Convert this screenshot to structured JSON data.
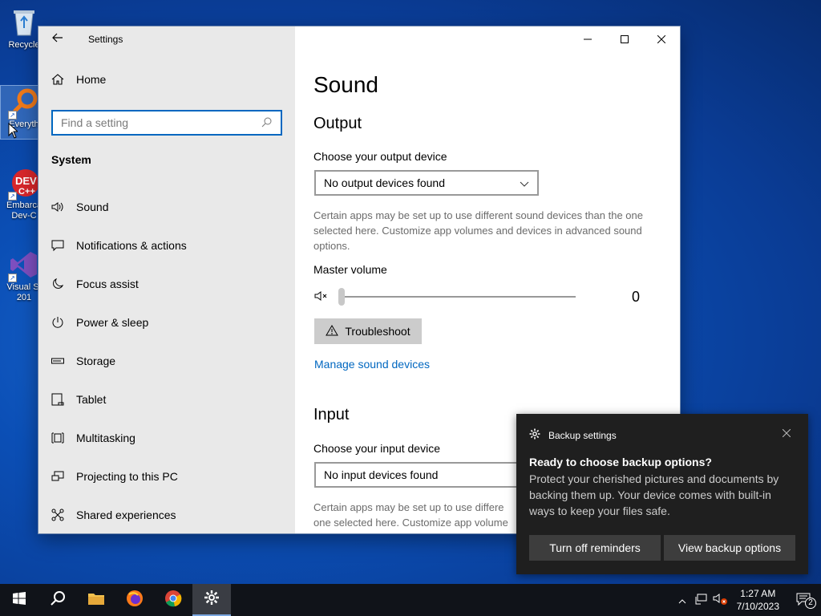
{
  "desktop": {
    "icons": [
      {
        "label": "Recycle"
      },
      {
        "label": "Everyth"
      },
      {
        "label": "Embarca\nDev-C"
      },
      {
        "label": "Visual St\n201"
      }
    ]
  },
  "window": {
    "app_title": "Settings",
    "nav": {
      "home_label": "Home",
      "search_placeholder": "Find a setting",
      "section_label": "System",
      "items": [
        {
          "label": "Sound",
          "icon": "speaker-icon"
        },
        {
          "label": "Notifications & actions",
          "icon": "notification-icon"
        },
        {
          "label": "Focus assist",
          "icon": "moon-icon"
        },
        {
          "label": "Power & sleep",
          "icon": "power-icon"
        },
        {
          "label": "Storage",
          "icon": "storage-icon"
        },
        {
          "label": "Tablet",
          "icon": "tablet-icon"
        },
        {
          "label": "Multitasking",
          "icon": "multitasking-icon"
        },
        {
          "label": "Projecting to this PC",
          "icon": "projecting-icon"
        },
        {
          "label": "Shared experiences",
          "icon": "shared-icon"
        }
      ]
    },
    "main": {
      "page_title": "Sound",
      "output": {
        "heading": "Output",
        "device_label": "Choose your output device",
        "device_value": "No output devices found",
        "description": "Certain apps may be set up to use different sound devices than the one selected here. Customize app volumes and devices in advanced sound options.",
        "volume_label": "Master volume",
        "volume_value": "0",
        "volume_level": 0,
        "troubleshoot_label": "Troubleshoot",
        "manage_link": "Manage sound devices"
      },
      "input": {
        "heading": "Input",
        "device_label": "Choose your input device",
        "device_value": "No input devices found",
        "description": "Certain apps may be set up to use differe one selected here. Customize app volume"
      }
    }
  },
  "toast": {
    "app_name": "Backup settings",
    "title": "Ready to choose backup options?",
    "body": "Protect your cherished pictures and documents by backing them up. Your device comes with built-in ways to keep your files safe.",
    "btn_off": "Turn off reminders",
    "btn_view": "View backup options"
  },
  "taskbar": {
    "time": "1:27 AM",
    "date": "7/10/2023",
    "notification_count": "2"
  },
  "colors": {
    "accent": "#0067c0",
    "nav_bg": "#e9e9e9",
    "toast_bg": "#1f1f1f",
    "taskbar_bg": "#101319"
  }
}
